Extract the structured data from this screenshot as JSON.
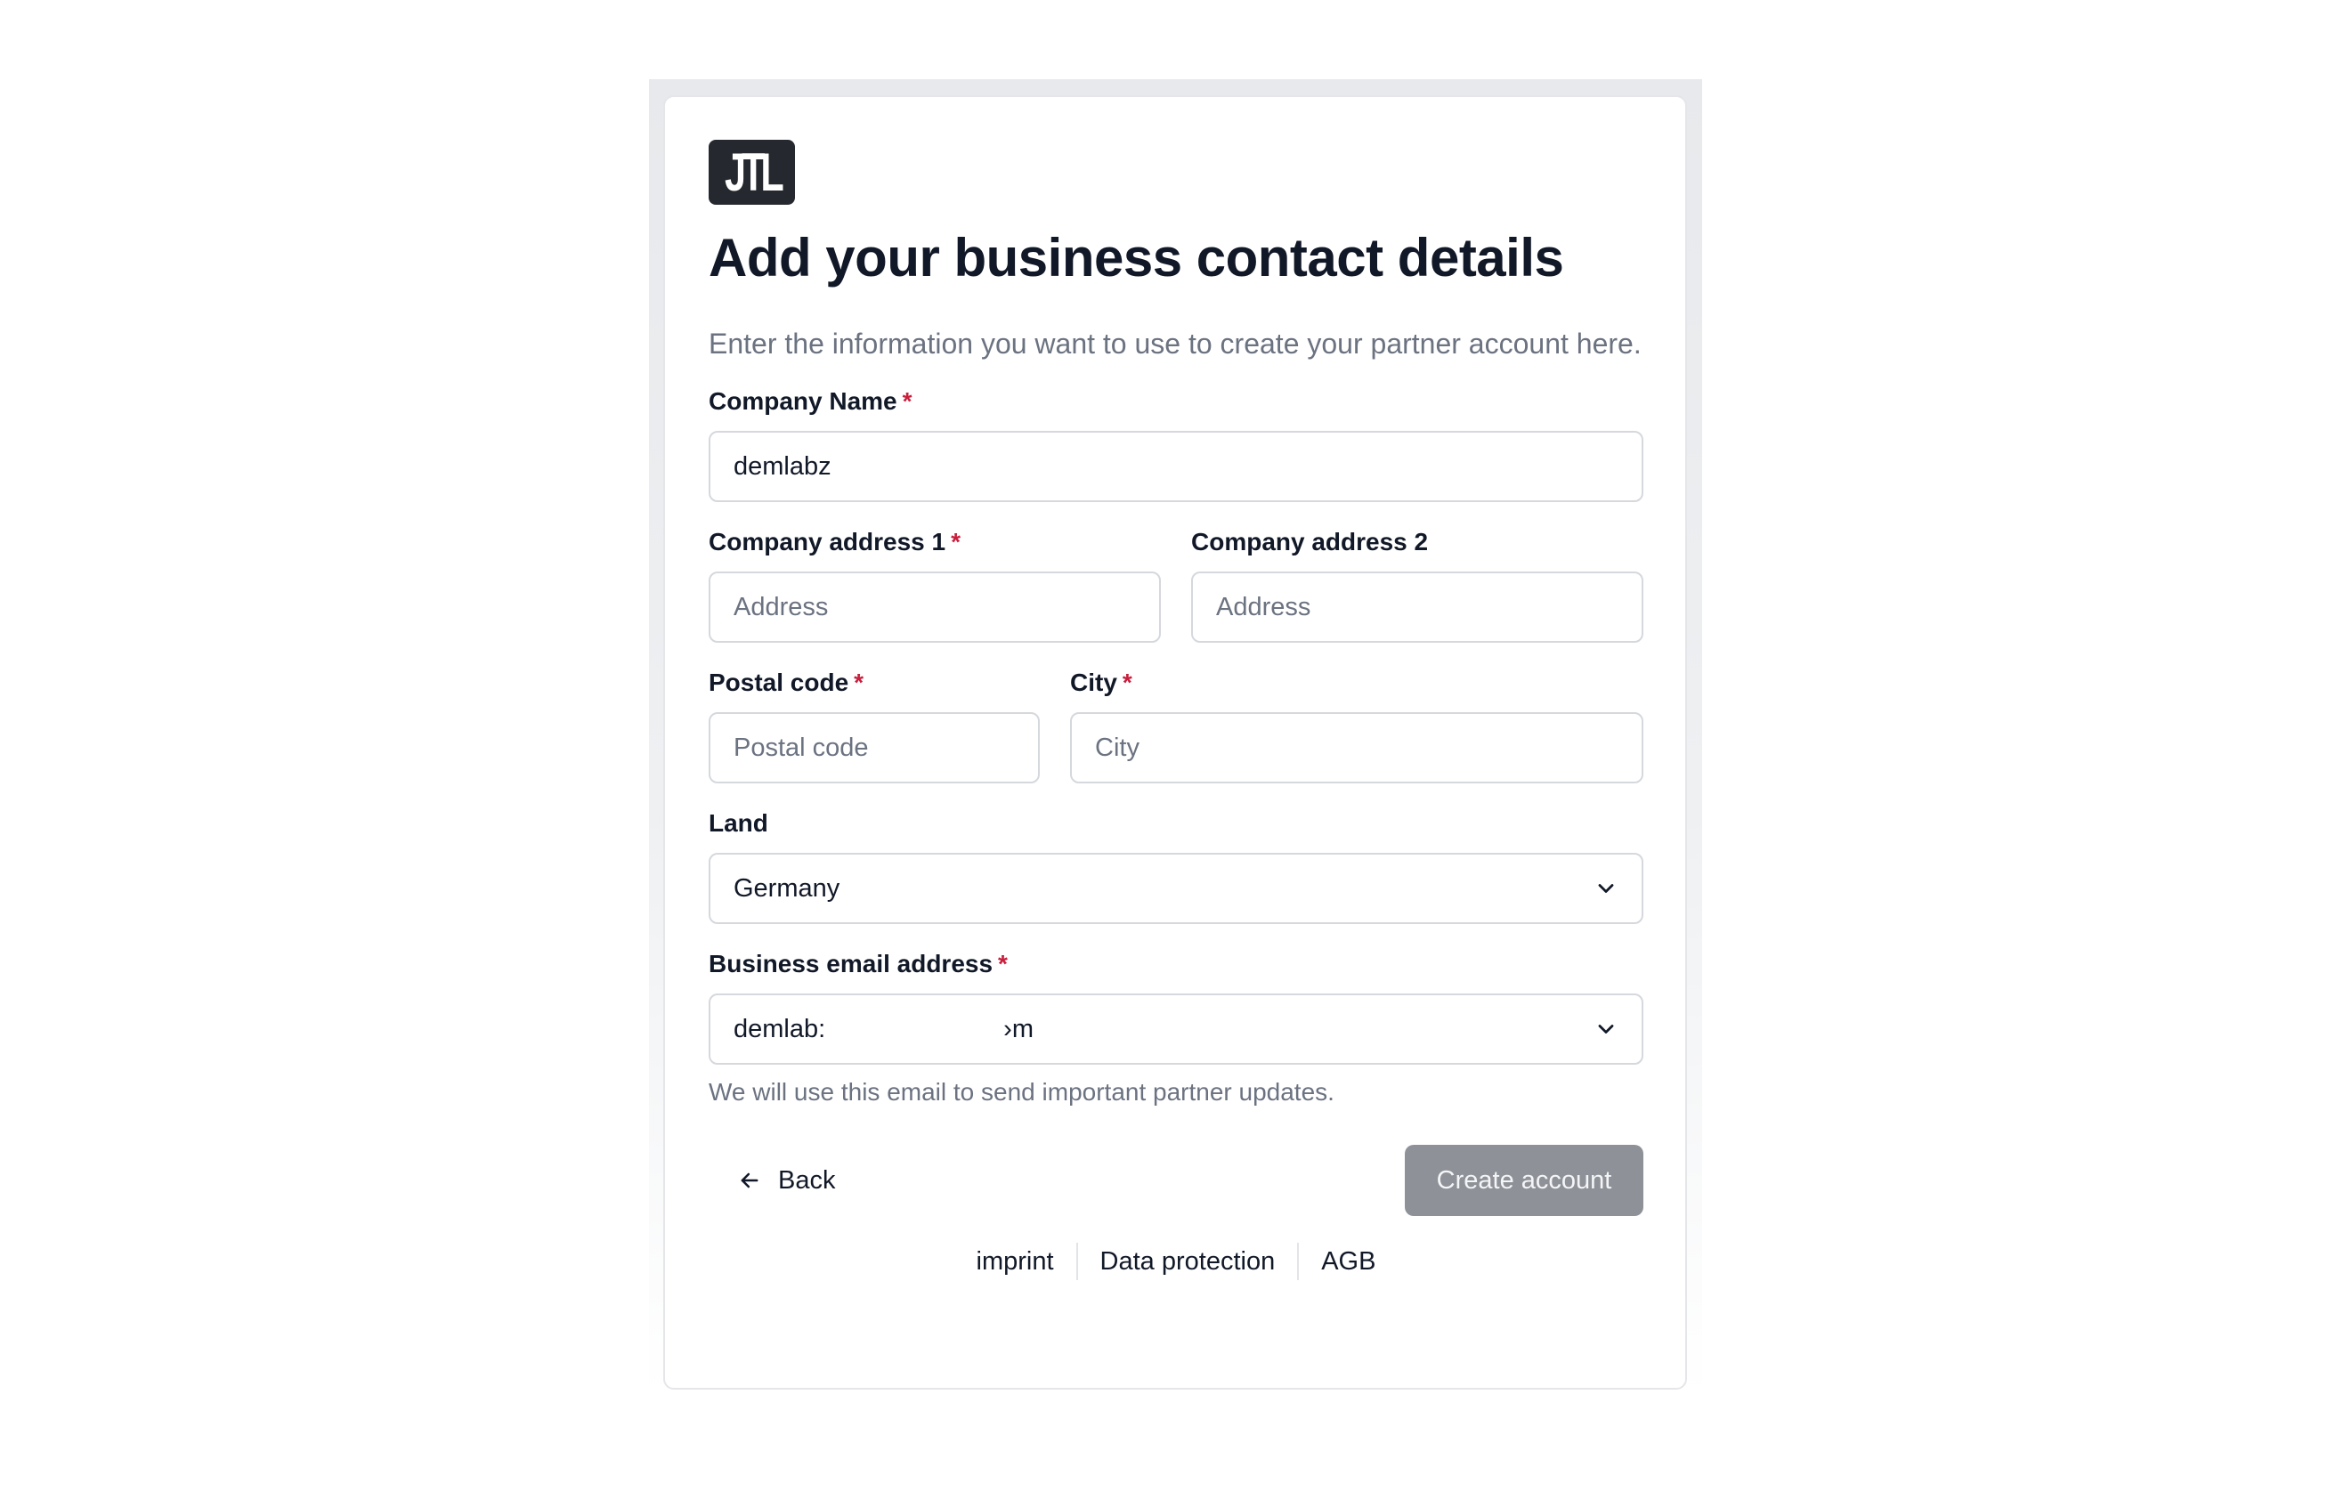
{
  "logo": {
    "text": "JTL"
  },
  "page": {
    "title": "Add your business contact details",
    "subtitle": "Enter the information you want to use to create your partner account here."
  },
  "form": {
    "required_marker": "*",
    "company_name": {
      "label": "Company Name",
      "value": "demlabz"
    },
    "address1": {
      "label": "Company address 1",
      "placeholder": "Address"
    },
    "address2": {
      "label": "Company address 2",
      "placeholder": "Address"
    },
    "postal_code": {
      "label": "Postal code",
      "placeholder": "Postal code"
    },
    "city": {
      "label": "City",
      "placeholder": "City"
    },
    "land": {
      "label": "Land",
      "value": "Germany"
    },
    "email": {
      "label": "Business email address",
      "value_start": "demlab:",
      "value_end": "›m",
      "hint": "We will use this email to send important partner updates."
    }
  },
  "actions": {
    "back_label": "Back",
    "create_label": "Create account"
  },
  "footer": {
    "links": [
      "imprint",
      "Data protection",
      "AGB"
    ]
  },
  "colors": {
    "required": "#c81e3c",
    "button_disabled": "#8e9197",
    "logo_bg": "#25292f"
  },
  "icons": {
    "back": "arrow-left-icon",
    "select": "chevron-down-icon"
  }
}
